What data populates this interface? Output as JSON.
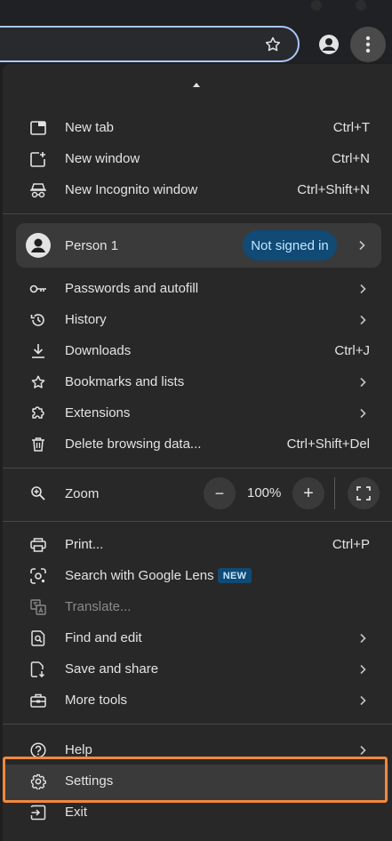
{
  "menu": {
    "new_tab": {
      "label": "New tab",
      "shortcut": "Ctrl+T"
    },
    "new_window": {
      "label": "New window",
      "shortcut": "Ctrl+N"
    },
    "new_incognito": {
      "label": "New Incognito window",
      "shortcut": "Ctrl+Shift+N"
    },
    "profile": {
      "name": "Person 1",
      "status": "Not signed in"
    },
    "passwords": {
      "label": "Passwords and autofill"
    },
    "history": {
      "label": "History"
    },
    "downloads": {
      "label": "Downloads",
      "shortcut": "Ctrl+J"
    },
    "bookmarks": {
      "label": "Bookmarks and lists"
    },
    "extensions": {
      "label": "Extensions"
    },
    "delete_data": {
      "label": "Delete browsing data...",
      "shortcut": "Ctrl+Shift+Del"
    },
    "zoom": {
      "label": "Zoom",
      "value": "100%",
      "minus": "−",
      "plus": "+"
    },
    "print": {
      "label": "Print...",
      "shortcut": "Ctrl+P"
    },
    "lens": {
      "label": "Search with Google Lens",
      "badge": "NEW"
    },
    "translate": {
      "label": "Translate..."
    },
    "find_edit": {
      "label": "Find and edit"
    },
    "save_share": {
      "label": "Save and share"
    },
    "more_tools": {
      "label": "More tools"
    },
    "help": {
      "label": "Help"
    },
    "settings": {
      "label": "Settings"
    },
    "exit": {
      "label": "Exit"
    }
  },
  "colors": {
    "menu_bg": "#282828",
    "badge_bg": "#104a75",
    "highlight_frame": "#f0883e",
    "omnibox_focus": "#a8c7fa"
  }
}
